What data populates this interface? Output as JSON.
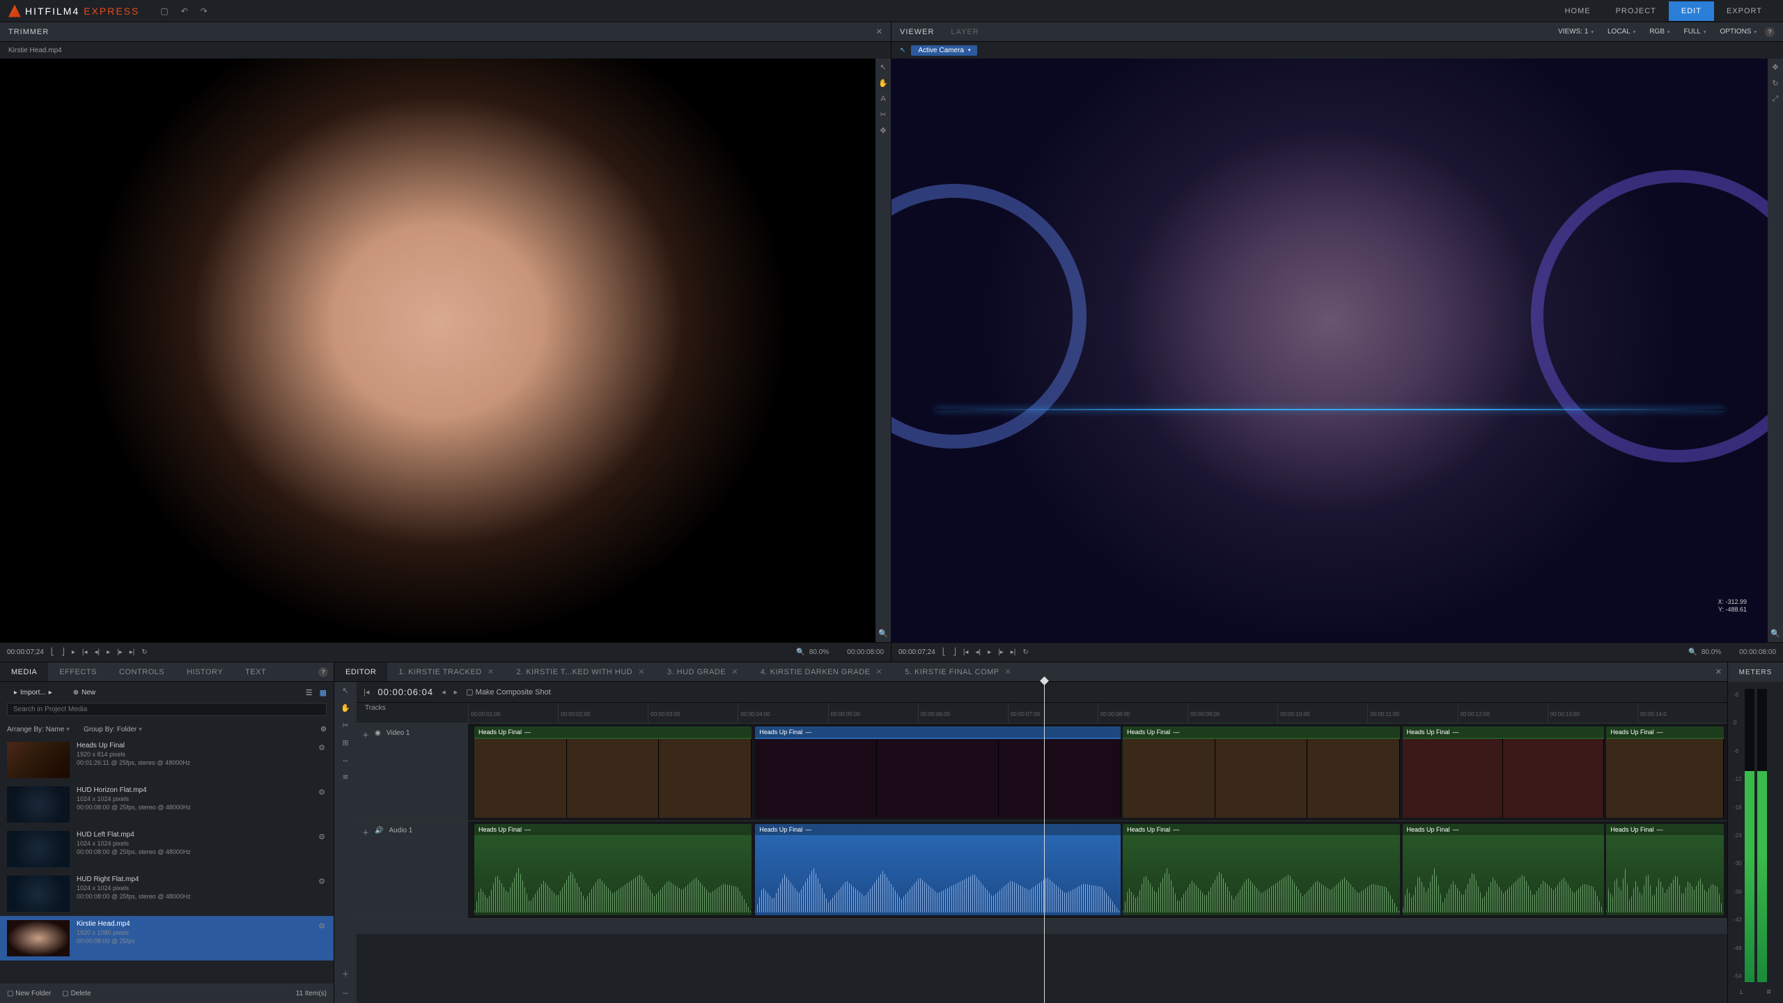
{
  "app": {
    "name1": "HITFILM4",
    "name2": "EXPRESS"
  },
  "topnav": [
    "HOME",
    "PROJECT",
    "EDIT",
    "EXPORT"
  ],
  "topnav_active": 2,
  "trimmer": {
    "title": "TRIMMER",
    "clip": "Kirstie Head.mp4",
    "timecode_left": "00:00:07;24",
    "timecode_right": "00:00:08:00",
    "zoom": "80.0%"
  },
  "viewer": {
    "tabs": [
      "VIEWER",
      "LAYER"
    ],
    "active_camera": "Active Camera",
    "options": {
      "views": "VIEWS: 1",
      "local": "LOCAL",
      "rgb": "RGB",
      "full": "FULL",
      "opts": "OPTIONS"
    },
    "coords": {
      "x": "X: -312.99",
      "y": "Y: -488.61"
    },
    "timecode_left": "00:00:07;24",
    "timecode_right": "00:00:08:00",
    "zoom": "80.0%"
  },
  "media": {
    "tabs": [
      "MEDIA",
      "EFFECTS",
      "CONTROLS",
      "HISTORY",
      "TEXT"
    ],
    "active_tab": 0,
    "import": "Import...",
    "new": "New",
    "search_ph": "Search in Project Media",
    "arrange": "Arrange By: Name",
    "group": "Group By: Folder",
    "items": [
      {
        "name": "Heads Up Final",
        "res": "1920 x 814 pixels",
        "dur": "00:01:26:11 @ 25fps, stereo @ 48000Hz"
      },
      {
        "name": "HUD Horizon Flat.mp4",
        "res": "1024 x 1024 pixels",
        "dur": "00:00:08:00 @ 25fps, stereo @ 48000Hz"
      },
      {
        "name": "HUD Left Flat.mp4",
        "res": "1024 x 1024 pixels",
        "dur": "00:00:08:00 @ 25fps, stereo @ 48000Hz"
      },
      {
        "name": "HUD Right Flat.mp4",
        "res": "1024 x 1024 pixels",
        "dur": "00:00:08:00 @ 25fps, stereo @ 48000Hz"
      },
      {
        "name": "Kirstie Head.mp4",
        "res": "1920 x 1080 pixels",
        "dur": "00:00:08:00 @ 25fps"
      }
    ],
    "selected": 4,
    "footer": {
      "newfolder": "New Folder",
      "delete": "Delete",
      "count": "11 Item(s)"
    }
  },
  "timeline": {
    "tabs": [
      {
        "label": "EDITOR"
      },
      {
        "label": "1. KIRSTIE TRACKED"
      },
      {
        "label": "2. KIRSTIE T...KED WITH HUD"
      },
      {
        "label": "3. HUD GRADE"
      },
      {
        "label": "4. KIRSTIE DARKEN GRADE"
      },
      {
        "label": "5. KIRSTIE FINAL COMP"
      }
    ],
    "active_tab": 0,
    "time": "00:00:06:04",
    "make_comp": "Make Composite Shot",
    "tracks_label": "Tracks",
    "ruler": [
      "00:00:01:00",
      "00:00:02:00",
      "00:00:03:00",
      "00:00:04:00",
      "00:00:05:00",
      "00:00:06:00",
      "00:00:07:00",
      "00:00:08:00",
      "00:00:09:00",
      "00:00:10:00",
      "00:00:11:00",
      "00:00:12:00",
      "00:00:13:00",
      "00:00:14:0"
    ],
    "video_track": "Video 1",
    "audio_track": "Audio 1",
    "clip_name": "Heads Up Final"
  },
  "meters": {
    "title": "METERS",
    "scale": [
      "-6",
      "0",
      "-6",
      "-12",
      "-18",
      "-24",
      "-30",
      "-36",
      "-42",
      "-48",
      "-54"
    ],
    "foot": [
      "L",
      "R"
    ]
  }
}
